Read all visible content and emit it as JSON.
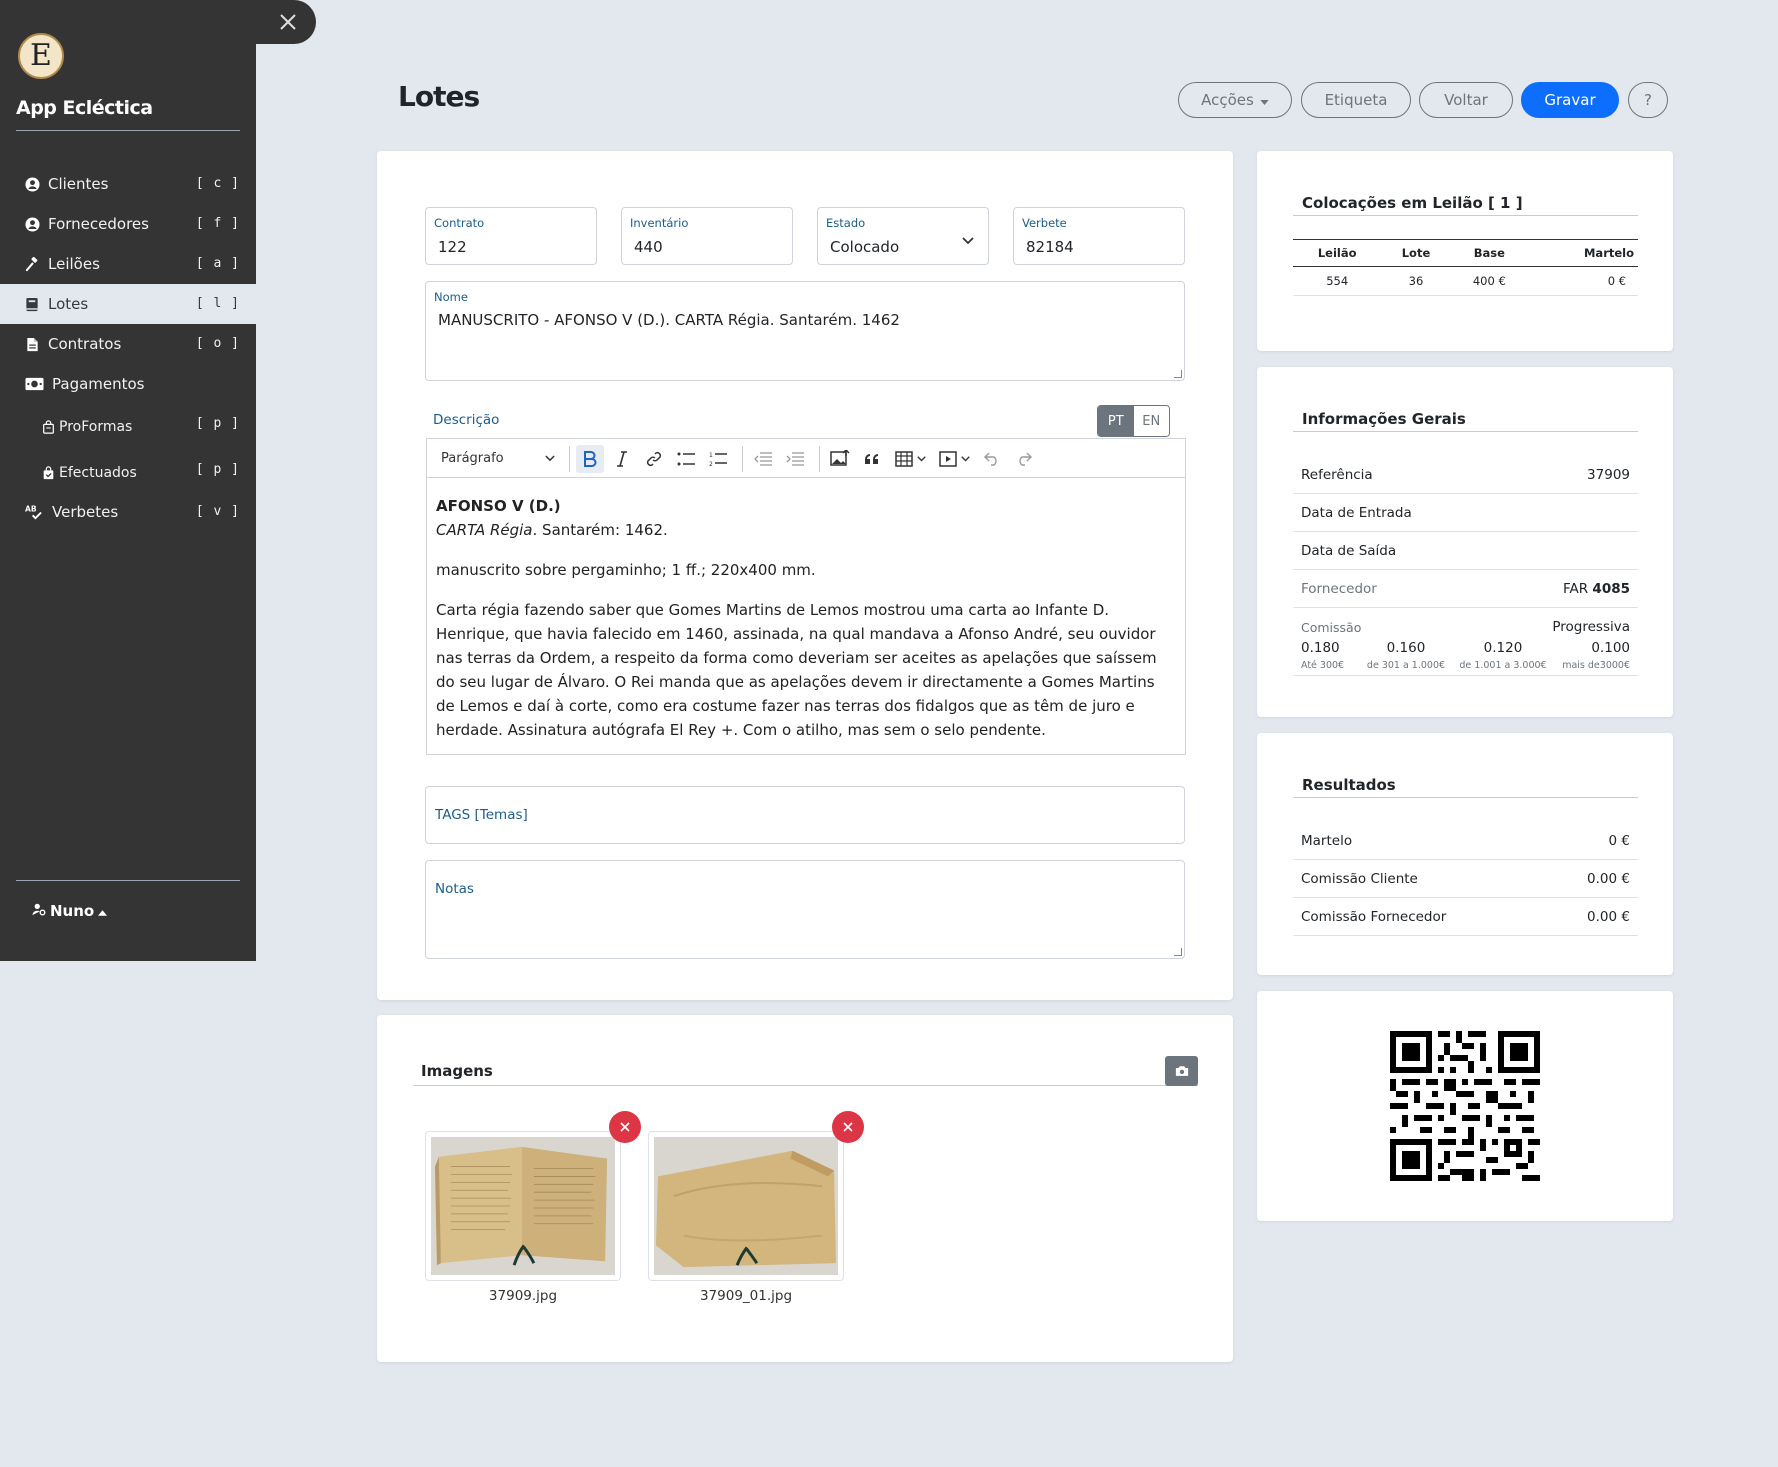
{
  "sidebar": {
    "brand": "App Ecléctica",
    "logo_letter": "E",
    "items": [
      {
        "label": "Clientes",
        "key": "[ c ]"
      },
      {
        "label": "Fornecedores",
        "key": "[ f ]"
      },
      {
        "label": "Leilões",
        "key": "[ a ]"
      },
      {
        "label": "Lotes",
        "key": "[ l ]"
      },
      {
        "label": "Contratos",
        "key": "[ o ]"
      },
      {
        "label": "Pagamentos",
        "key": ""
      },
      {
        "label": "ProFormas",
        "key": "[ p ]"
      },
      {
        "label": "Efectuados",
        "key": "[ p ]"
      },
      {
        "label": "Verbetes",
        "key": "[ v ]"
      }
    ],
    "user": "Nuno"
  },
  "header": {
    "title": "Lotes",
    "actions_label": "Acções",
    "label_button": "Etiqueta",
    "back_button": "Voltar",
    "save_button": "Gravar",
    "help_button": "?"
  },
  "form": {
    "contrato": {
      "label": "Contrato",
      "value": "122"
    },
    "inventario": {
      "label": "Inventário",
      "value": "440"
    },
    "estado": {
      "label": "Estado",
      "value": "Colocado"
    },
    "verbete": {
      "label": "Verbete",
      "value": "82184"
    },
    "nome": {
      "label": "Nome",
      "value": "MANUSCRITO - AFONSO V (D.). CARTA Régia. Santarém. 1462"
    },
    "descricao_label": "Descrição",
    "lang_pt": "PT",
    "lang_en": "EN",
    "paragraph_select": "Parágrafo",
    "desc_author": "AFONSO V (D.)",
    "desc_title_italic": "CARTA Régia",
    "desc_title_rest": ". Santarém: 1462.",
    "desc_p2": "manuscrito sobre pergaminho; 1 ff.; 220x400 mm.",
    "desc_p3": "Carta régia fazendo saber que Gomes Martins de Lemos mostrou uma carta ao Infante D. Henrique, que havia falecido em 1460, assinada, na qual mandava a Afonso André, seu ouvidor nas terras da Ordem, a respeito da forma como deveriam ser aceites as apelações que saíssem do seu lugar de Álvaro. O Rei manda que as apelações devem ir directamente a Gomes Martins de Lemos e daí à corte, como era costume fazer nas terras dos fidalgos que as têm de juro e herdade. Assinatura autógrafa El Rey +. Com o atilho, mas sem o selo pendente.",
    "tags_label": "TAGS [Temas]",
    "notas_label": "Notas"
  },
  "images": {
    "title": "Imagens",
    "files": [
      "37909.jpg",
      "37909_01.jpg"
    ]
  },
  "colocacoes": {
    "title": "Colocações em Leilão [ 1 ]",
    "headers": [
      "Leilão",
      "Lote",
      "Base",
      "Martelo"
    ],
    "rows": [
      [
        "554",
        "36",
        "400 €",
        "0 €"
      ]
    ]
  },
  "info": {
    "title": "Informações Gerais",
    "referencia_label": "Referência",
    "referencia_value": "37909",
    "entrada_label": "Data de Entrada",
    "saida_label": "Data de Saída",
    "fornecedor_label": "Fornecedor",
    "fornecedor_prefix": "FAR",
    "fornecedor_value": "4085",
    "comissao_label": "Comissão",
    "comissao_type": "Progressiva",
    "tiers": [
      {
        "value": "0.180",
        "range": "Até 300€"
      },
      {
        "value": "0.160",
        "range": "de 301 a 1.000€"
      },
      {
        "value": "0.120",
        "range": "de 1.001 a 3.000€"
      },
      {
        "value": "0.100",
        "range": "mais de3000€"
      }
    ]
  },
  "resultados": {
    "title": "Resultados",
    "martelo_label": "Martelo",
    "martelo_value": "0 €",
    "com_cliente_label": "Comissão Cliente",
    "com_cliente_value": "0.00 €",
    "com_fornecedor_label": "Comissão Fornecedor",
    "com_fornecedor_value": "0.00 €"
  },
  "colors": {
    "sidebar_bg": "#343434",
    "page_bg": "#e3e7ee",
    "primary": "#0d6efd",
    "danger": "#dc3545",
    "label_blue": "#1b5d8c"
  }
}
